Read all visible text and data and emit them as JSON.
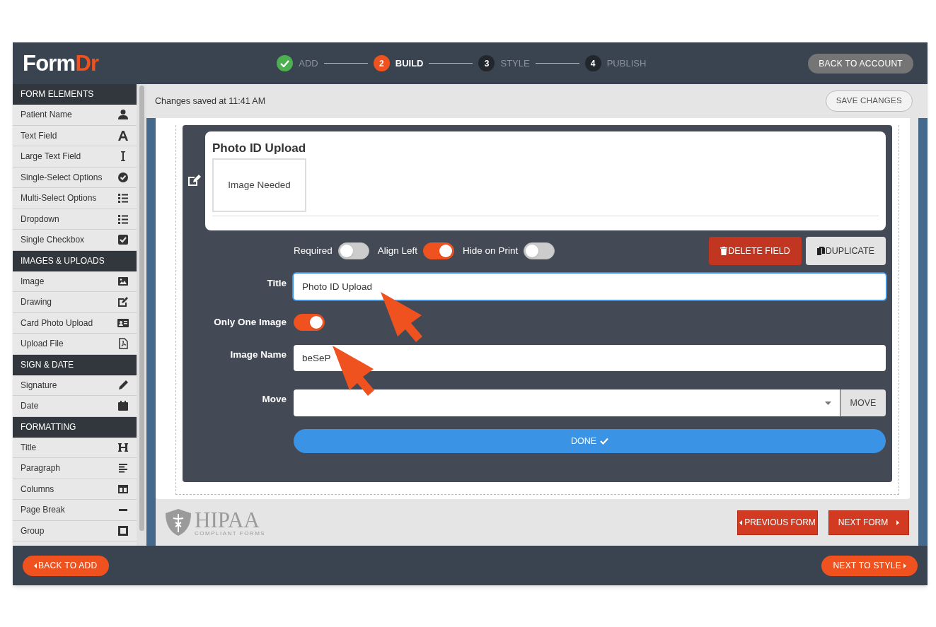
{
  "logo": {
    "main": "Form",
    "accent": "Dr"
  },
  "steps": [
    {
      "label": "ADD",
      "completed": true,
      "current": false
    },
    {
      "number": "2",
      "label": "BUILD",
      "completed": false,
      "current": true
    },
    {
      "number": "3",
      "label": "STYLE",
      "completed": false,
      "current": false
    },
    {
      "number": "4",
      "label": "PUBLISH",
      "completed": false,
      "current": false
    }
  ],
  "back_to_account": "BACK TO ACCOUNT",
  "sidebar": [
    {
      "title": "FORM ELEMENTS",
      "items": [
        "Patient Name",
        "Text Field",
        "Large Text Field",
        "Single-Select Options",
        "Multi-Select Options",
        "Dropdown",
        "Single Checkbox"
      ]
    },
    {
      "title": "IMAGES & UPLOADS",
      "items": [
        "Image",
        "Drawing",
        "Card Photo Upload",
        "Upload File"
      ]
    },
    {
      "title": "SIGN & DATE",
      "items": [
        "Signature",
        "Date"
      ]
    },
    {
      "title": "FORMATTING",
      "items": [
        "Title",
        "Paragraph",
        "Columns",
        "Page Break",
        "Group"
      ]
    }
  ],
  "status": "Changes saved at 11:41 AM",
  "save_changes": "SAVE CHANGES",
  "preview": {
    "title": "Photo ID Upload",
    "image_placeholder": "Image Needed"
  },
  "toggles": [
    {
      "label": "Required",
      "on": false
    },
    {
      "label": "Align Left",
      "on": true
    },
    {
      "label": "Hide on Print",
      "on": false
    }
  ],
  "delete_field": "DELETE FIELD",
  "duplicate": "DUPLICATE",
  "title_field": {
    "label": "Title",
    "value": "Photo ID Upload",
    "focused": true
  },
  "only_one_image": {
    "label": "Only One Image",
    "on": true
  },
  "image_name": {
    "label": "Image Name",
    "value": "beSeP"
  },
  "move": {
    "label": "Move",
    "button": "MOVE"
  },
  "done": "DONE",
  "hipaa": {
    "name": "HIPAA",
    "sub": "COMPLIANT FORMS"
  },
  "previous_form": "PREVIOUS FORM",
  "next_form": "NEXT FORM",
  "back_to_add": "BACK TO ADD",
  "next_to_style": "NEXT TO STYLE"
}
